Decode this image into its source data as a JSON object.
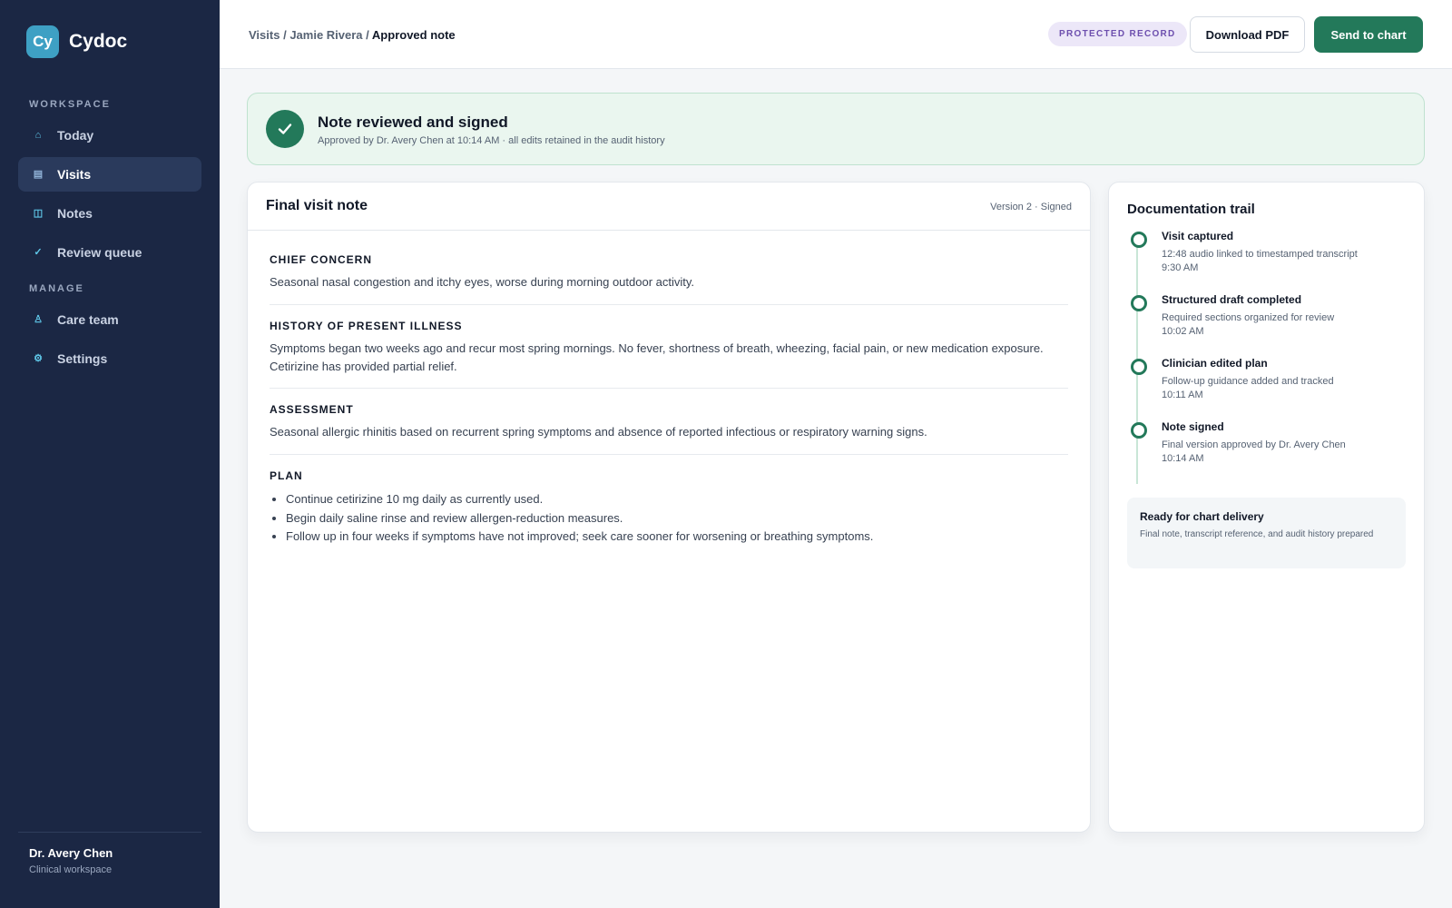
{
  "app": {
    "logo_text": "Cy",
    "name": "Cydoc"
  },
  "sidebar": {
    "sections": [
      {
        "label": "WORKSPACE",
        "items": [
          {
            "label": "Today",
            "icon": "home-icon"
          },
          {
            "label": "Visits",
            "icon": "list-icon",
            "active": true
          },
          {
            "label": "Notes",
            "icon": "notes-icon"
          },
          {
            "label": "Review queue",
            "icon": "check-icon"
          }
        ]
      },
      {
        "label": "MANAGE",
        "items": [
          {
            "label": "Care team",
            "icon": "people-icon"
          },
          {
            "label": "Settings",
            "icon": "gear-icon"
          }
        ]
      }
    ],
    "user": {
      "name": "Dr. Avery Chen",
      "role": "Clinical workspace"
    }
  },
  "header": {
    "breadcrumb": {
      "parts": [
        "Visits",
        "Jamie Rivera"
      ],
      "current": "Approved note"
    },
    "badge": "PROTECTED RECORD",
    "download_label": "Download PDF",
    "send_label": "Send to chart"
  },
  "banner": {
    "title": "Note reviewed and signed",
    "subtitle": "Approved by Dr. Avery Chen at 10:14 AM · all edits retained in the audit history"
  },
  "note": {
    "title": "Final visit note",
    "version": "Version 2 · Signed",
    "sections": [
      {
        "label": "CHIEF CONCERN",
        "text": "Seasonal nasal congestion and itchy eyes, worse during morning outdoor activity."
      },
      {
        "label": "HISTORY OF PRESENT ILLNESS",
        "text": "Symptoms began two weeks ago and recur most spring mornings. No fever, shortness of breath, wheezing, facial pain, or new medication exposure. Cetirizine has provided partial relief."
      },
      {
        "label": "ASSESSMENT",
        "text": "Seasonal allergic rhinitis based on recurrent spring symptoms and absence of reported infectious or respiratory warning signs."
      },
      {
        "label": "PLAN",
        "items": [
          "Continue cetirizine 10 mg daily as currently used.",
          "Begin daily saline rinse and review allergen-reduction measures.",
          "Follow up in four weeks if symptoms have not improved; seek care sooner for worsening or breathing symptoms."
        ]
      }
    ]
  },
  "trail": {
    "title": "Documentation trail",
    "events": [
      {
        "label": "Visit captured",
        "detail": "12:48 audio linked to timestamped transcript",
        "time": "9:30 AM"
      },
      {
        "label": "Structured draft completed",
        "detail": "Required sections organized for review",
        "time": "10:02 AM"
      },
      {
        "label": "Clinician edited plan",
        "detail": "Follow-up guidance added and tracked",
        "time": "10:11 AM"
      },
      {
        "label": "Note signed",
        "detail": "Final version approved by Dr. Avery Chen",
        "time": "10:14 AM"
      }
    ],
    "ready": {
      "title": "Ready for chart delivery",
      "detail": "Final note, transcript reference, and audit history prepared"
    }
  },
  "colors": {
    "sidebar_bg": "#1b2744",
    "accent_green": "#23795a",
    "logo_blue": "#3ea0c4",
    "badge_purple": "#6d4fae"
  }
}
